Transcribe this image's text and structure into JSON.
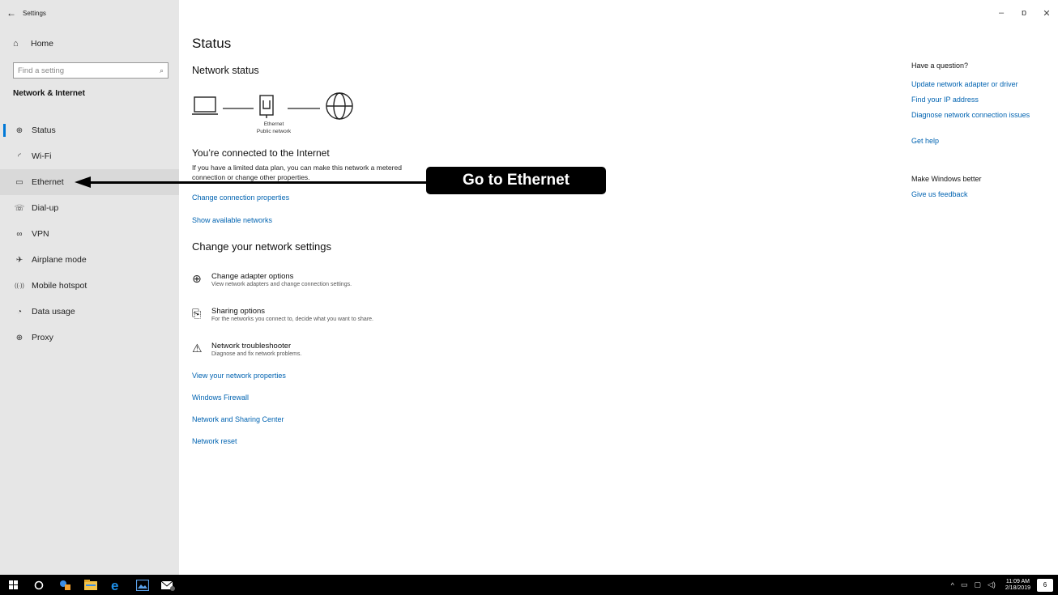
{
  "window": {
    "app_title": "Settings",
    "back_icon": "←",
    "minimize_icon": "–",
    "maximize_icon": "ɒ",
    "close_icon": "✕"
  },
  "sidebar": {
    "home": {
      "label": "Home",
      "icon": "⌂"
    },
    "search": {
      "placeholder": "Find a setting",
      "icon": "⌕"
    },
    "section_heading": "Network & Internet",
    "items": [
      {
        "label": "Status",
        "icon": "⊕",
        "active": true
      },
      {
        "label": "Wi-Fi",
        "icon": "◜"
      },
      {
        "label": "Ethernet",
        "icon": "▭"
      },
      {
        "label": "Dial-up",
        "icon": "☏"
      },
      {
        "label": "VPN",
        "icon": "∞"
      },
      {
        "label": "Airplane mode",
        "icon": "✈"
      },
      {
        "label": "Mobile hotspot",
        "icon": "((·))"
      },
      {
        "label": "Data usage",
        "icon": "◔"
      },
      {
        "label": "Proxy",
        "icon": "⊕"
      }
    ]
  },
  "main": {
    "title": "Status",
    "network_status_heading": "Network status",
    "diagram": {
      "adapter_label": "Ethernet",
      "network_label": "Public network"
    },
    "connected_title": "You’re connected to the Internet",
    "connected_desc": "If you have a limited data plan, you can make this network a metered connection or change other properties.",
    "link_change_properties": "Change connection properties",
    "link_show_networks": "Show available networks",
    "change_settings_heading": "Change your network settings",
    "options": [
      {
        "title": "Change adapter options",
        "desc": "View network adapters and change connection settings.",
        "icon": "⊕"
      },
      {
        "title": "Sharing options",
        "desc": "For the networks you connect to, decide what you want to share.",
        "icon": "⎘"
      },
      {
        "title": "Network troubleshooter",
        "desc": "Diagnose and fix network problems.",
        "icon": "⚠"
      }
    ],
    "links": [
      "View your network properties",
      "Windows Firewall",
      "Network and Sharing Center",
      "Network reset"
    ]
  },
  "rail": {
    "question_heading": "Have a question?",
    "question_links": [
      "Update network adapter or driver",
      "Find your IP address",
      "Diagnose network connection issues",
      "Get help"
    ],
    "better_heading": "Make Windows better",
    "feedback_link": "Give us feedback"
  },
  "callout": {
    "text": "Go to Ethernet"
  },
  "taskbar": {
    "clock_time": "11:09 AM",
    "clock_date": "2/18/2019",
    "notification_count": "6",
    "tray_chevron": "^"
  }
}
